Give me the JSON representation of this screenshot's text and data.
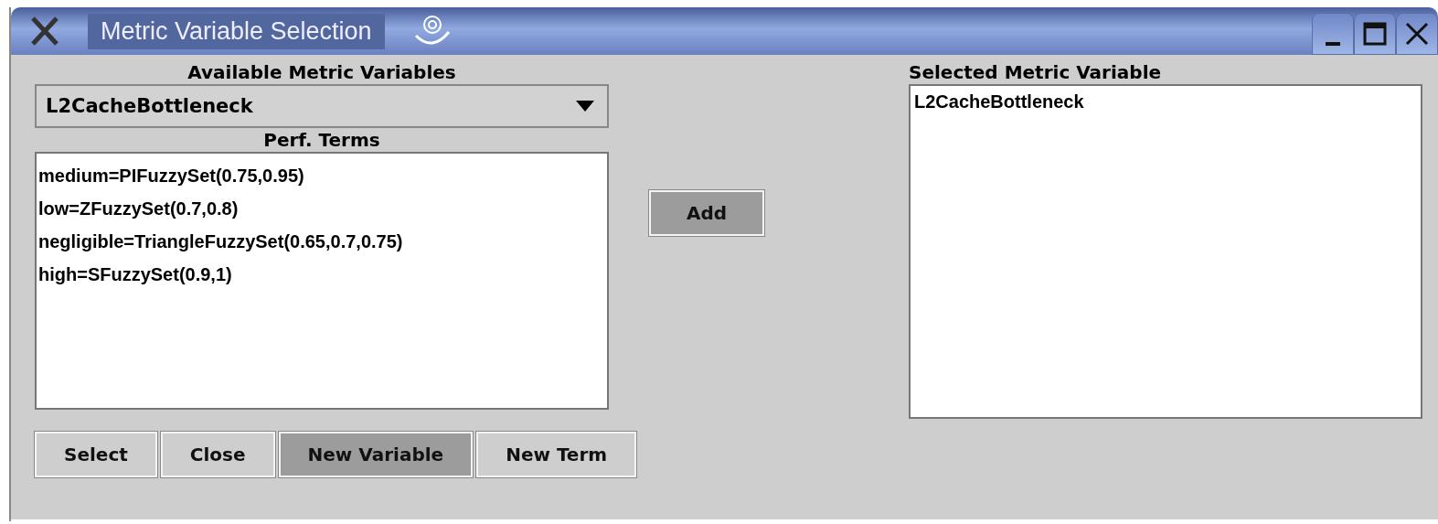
{
  "window": {
    "title": "Metric Variable Selection"
  },
  "available": {
    "label": "Available Metric Variables",
    "value": "L2CacheBottleneck"
  },
  "terms": {
    "label": "Perf. Terms",
    "items": [
      {
        "text": "medium=PIFuzzySet(0.75,0.95)",
        "selected": false
      },
      {
        "text": "low=ZFuzzySet(0.7,0.8)",
        "selected": false
      },
      {
        "text": "negligible=TriangleFuzzySet(0.65,0.7,0.75)",
        "selected": false
      },
      {
        "text": "high=SFuzzySet(0.9,1)",
        "selected": false
      }
    ]
  },
  "add_button": {
    "label": "Add",
    "pressed": true
  },
  "selected_panel": {
    "label": "Selected Metric Variable",
    "items": [
      "L2CacheBottleneck"
    ]
  },
  "buttons": [
    {
      "label": "Select",
      "pressed": false
    },
    {
      "label": "Close",
      "pressed": false
    },
    {
      "label": "New Variable",
      "pressed": true
    },
    {
      "label": "New Term",
      "pressed": false
    }
  ]
}
